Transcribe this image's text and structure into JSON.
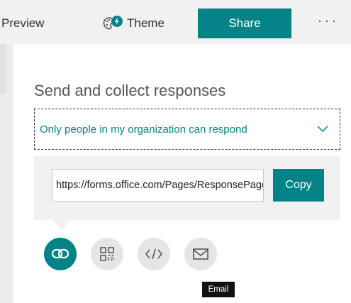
{
  "topbar": {
    "preview_label": "Preview",
    "theme_label": "Theme",
    "share_label": "Share",
    "more_label": "···"
  },
  "panel": {
    "title": "Send and collect responses",
    "permission_selected": "Only people in my organization can respond",
    "url_value": "https://forms.office.com/Pages/ResponsePage.aspx",
    "copy_label": "Copy",
    "share_options": [
      "link-icon",
      "qr-code-icon",
      "embed-icon",
      "email-icon"
    ],
    "tooltip": "Email"
  },
  "colors": {
    "accent": "#038387"
  }
}
